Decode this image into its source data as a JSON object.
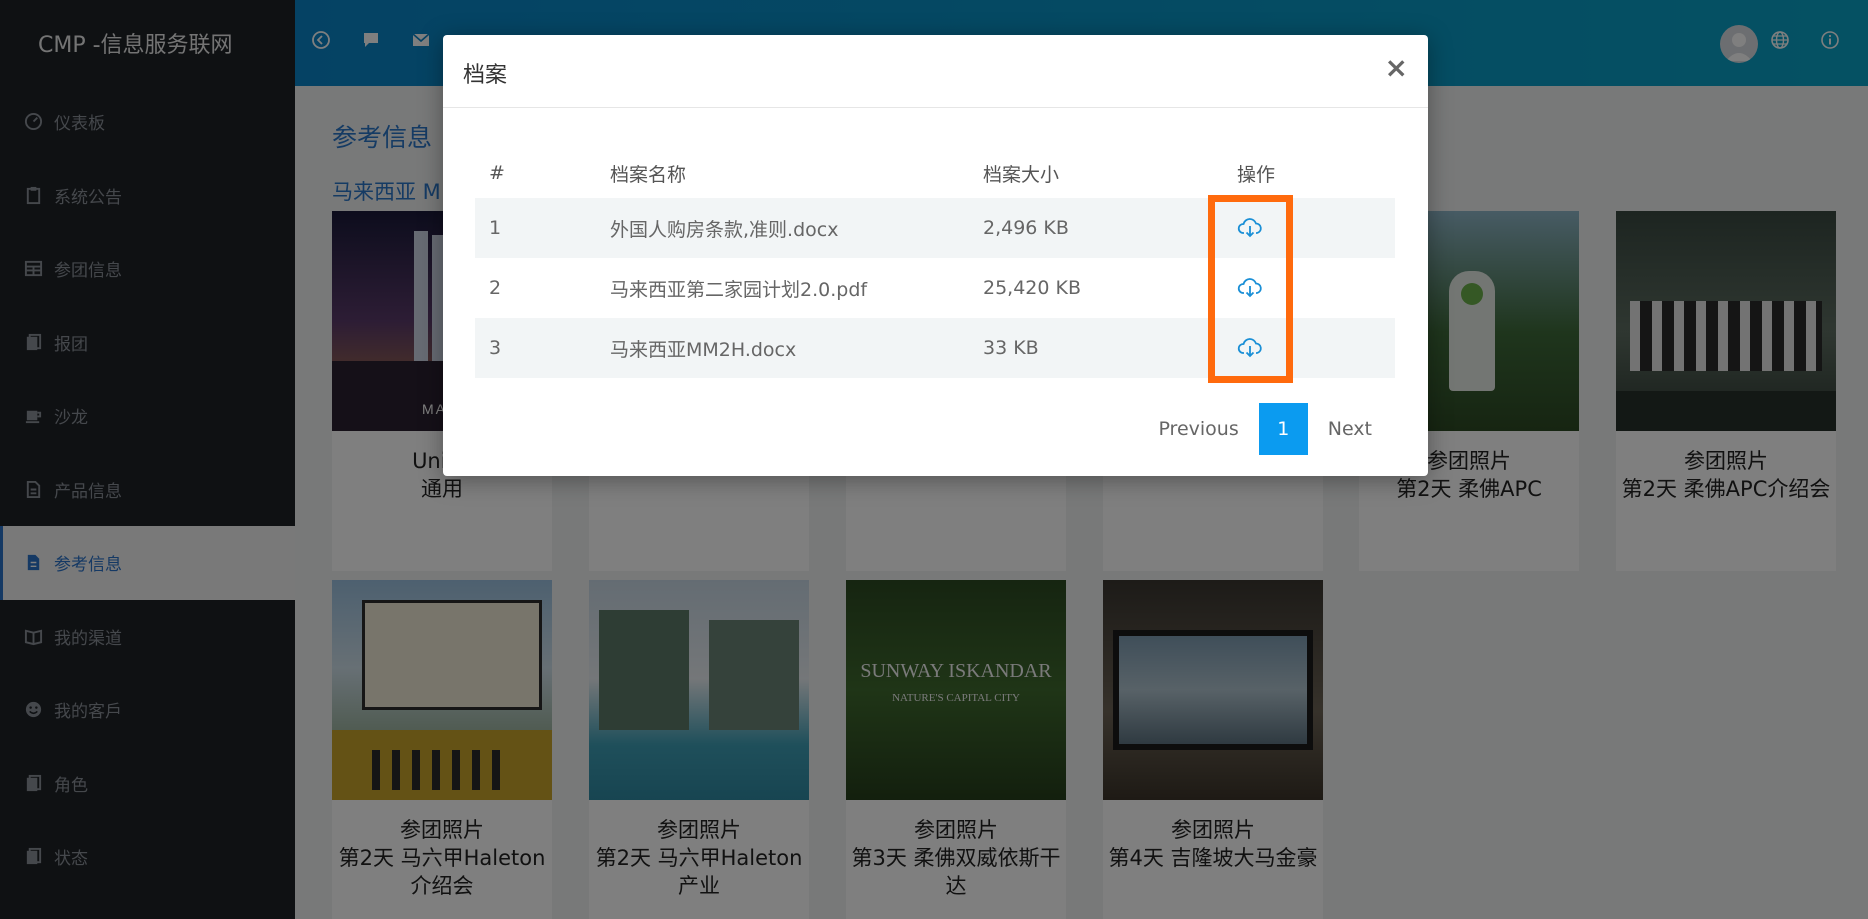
{
  "app": {
    "title": "CMP -信息服务联网"
  },
  "sidebar": {
    "items": [
      {
        "label": "仪表板",
        "icon": "dashboard-icon"
      },
      {
        "label": "系统公告",
        "icon": "clipboard-icon"
      },
      {
        "label": "参团信息",
        "icon": "table-icon"
      },
      {
        "label": "报团",
        "icon": "book-icon"
      },
      {
        "label": "沙龙",
        "icon": "coffee-icon"
      },
      {
        "label": "产品信息",
        "icon": "document-icon"
      },
      {
        "label": "参考信息",
        "icon": "document-icon",
        "active": true
      },
      {
        "label": "我的渠道",
        "icon": "open-book-icon"
      },
      {
        "label": "我的客戶",
        "icon": "smile-icon"
      },
      {
        "label": "角色",
        "icon": "book-icon"
      },
      {
        "label": "状态",
        "icon": "book-icon"
      }
    ]
  },
  "header": {
    "icons": [
      "back-icon",
      "chat-icon",
      "mail-icon",
      "user-avatar",
      "globe-icon",
      "info-icon"
    ]
  },
  "main": {
    "page_title": "参考信息",
    "section_title": "马来西亚 M",
    "cards_row1": [
      {
        "caption_line1": "Unive",
        "caption_line2": "通用",
        "photo_text": "MALA"
      },
      {
        "caption_line1": "参团照片",
        "caption_line2": "第2天 柔佛APC"
      },
      {
        "caption_line1": "参团照片",
        "caption_line2": "第2天 柔佛APC介绍会"
      }
    ],
    "cards_row2": [
      {
        "caption_line1": "参团照片",
        "caption_line2": "第2天 马六甲Haleton",
        "caption_line3": "介绍会"
      },
      {
        "caption_line1": "参团照片",
        "caption_line2": "第2天 马六甲Haleton",
        "caption_line3": "产业"
      },
      {
        "caption_line1": "参团照片",
        "caption_line2": "第3天 柔佛双威依斯干",
        "caption_line3": "达",
        "photo_text1": "SUNWAY ISKANDAR",
        "photo_text2": "NATURE'S CAPITAL CITY"
      },
      {
        "caption_line1": "参团照片",
        "caption_line2": "第4天 吉隆坡大马金豪"
      }
    ]
  },
  "modal": {
    "title": "档案",
    "close_label": "×",
    "columns": [
      "#",
      "档案名称",
      "档案大小",
      "操作"
    ],
    "rows": [
      {
        "num": "1",
        "name": "外国人购房条款,准则.docx",
        "size": "2,496 KB"
      },
      {
        "num": "2",
        "name": "马来西亚第二家园计划2.0.pdf",
        "size": "25,420 KB"
      },
      {
        "num": "3",
        "name": "马来西亚MM2H.docx",
        "size": "33 KB"
      }
    ],
    "pagination": {
      "previous": "Previous",
      "current": "1",
      "next": "Next"
    }
  },
  "colors": {
    "accent": "#0b9bf0",
    "highlight": "#ff6a0d",
    "header": "#0b85c8",
    "sidebar": "#1e2227"
  }
}
